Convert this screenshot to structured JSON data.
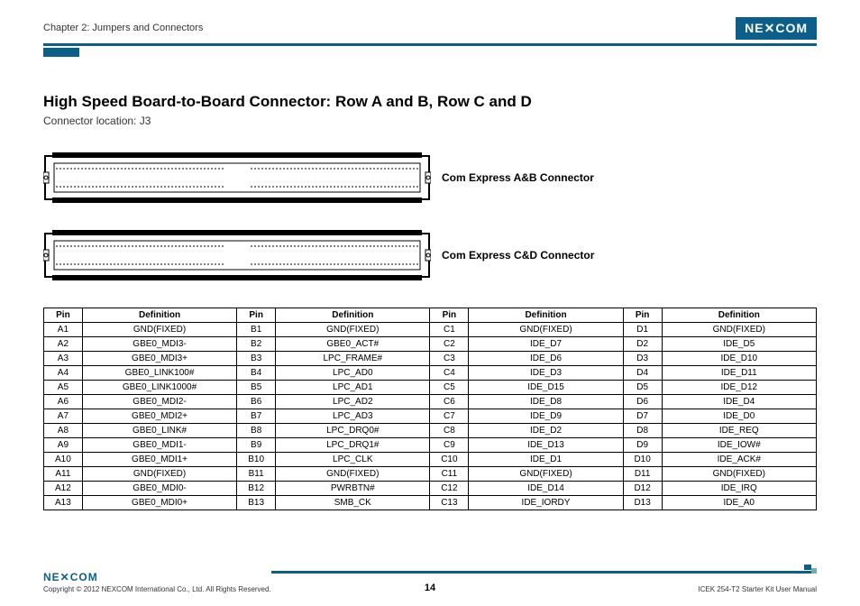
{
  "header": {
    "chapter": "Chapter 2: Jumpers and Connectors",
    "logo_text": "NE✕COM"
  },
  "title_block": {
    "title": "High Speed Board-to-Board Connector: Row A and B, Row C and D",
    "subtitle": "Connector location: J3"
  },
  "connectors": {
    "ab_label": "Com Express A&B Connector",
    "cd_label": "Com Express C&D Connector"
  },
  "pin_table": {
    "headers": [
      "Pin",
      "Definition",
      "Pin",
      "Definition",
      "Pin",
      "Definition",
      "Pin",
      "Definition"
    ],
    "rows": [
      [
        "A1",
        "GND(FIXED)",
        "B1",
        "GND(FIXED)",
        "C1",
        "GND(FIXED)",
        "D1",
        "GND(FIXED)"
      ],
      [
        "A2",
        "GBE0_MDI3-",
        "B2",
        "GBE0_ACT#",
        "C2",
        "IDE_D7",
        "D2",
        "IDE_D5"
      ],
      [
        "A3",
        "GBE0_MDI3+",
        "B3",
        "LPC_FRAME#",
        "C3",
        "IDE_D6",
        "D3",
        "IDE_D10"
      ],
      [
        "A4",
        "GBE0_LINK100#",
        "B4",
        "LPC_AD0",
        "C4",
        "IDE_D3",
        "D4",
        "IDE_D11"
      ],
      [
        "A5",
        "GBE0_LINK1000#",
        "B5",
        "LPC_AD1",
        "C5",
        "IDE_D15",
        "D5",
        "IDE_D12"
      ],
      [
        "A6",
        "GBE0_MDI2-",
        "B6",
        "LPC_AD2",
        "C6",
        "IDE_D8",
        "D6",
        "IDE_D4"
      ],
      [
        "A7",
        "GBE0_MDI2+",
        "B7",
        "LPC_AD3",
        "C7",
        "IDE_D9",
        "D7",
        "IDE_D0"
      ],
      [
        "A8",
        "GBE0_LINK#",
        "B8",
        "LPC_DRQ0#",
        "C8",
        "IDE_D2",
        "D8",
        "IDE_REQ"
      ],
      [
        "A9",
        "GBE0_MDI1-",
        "B9",
        "LPC_DRQ1#",
        "C9",
        "IDE_D13",
        "D9",
        "IDE_IOW#"
      ],
      [
        "A10",
        "GBE0_MDI1+",
        "B10",
        "LPC_CLK",
        "C10",
        "IDE_D1",
        "D10",
        "IDE_ACK#"
      ],
      [
        "A11",
        "GND(FIXED)",
        "B11",
        "GND(FIXED)",
        "C11",
        "GND(FIXED)",
        "D11",
        "GND(FIXED)"
      ],
      [
        "A12",
        "GBE0_MDI0-",
        "B12",
        "PWRBTN#",
        "C12",
        "IDE_D14",
        "D12",
        "IDE_IRQ"
      ],
      [
        "A13",
        "GBE0_MDI0+",
        "B13",
        "SMB_CK",
        "C13",
        "IDE_IORDY",
        "D13",
        "IDE_A0"
      ]
    ]
  },
  "footer": {
    "logo_text": "NE✕COM",
    "copyright": "Copyright © 2012 NEXCOM International Co., Ltd. All Rights Reserved.",
    "page": "14",
    "doc": "ICEK 254-T2 Starter Kit User Manual"
  }
}
